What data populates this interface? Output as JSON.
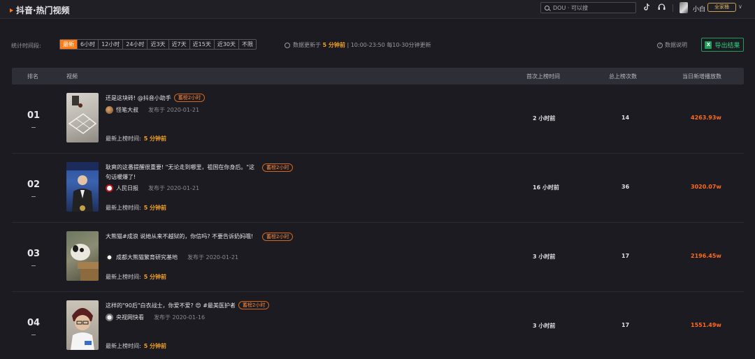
{
  "header": {
    "title": "抖音·热门视频",
    "search_placeholder": "DOU · 可以搜",
    "user_name": "小白",
    "user_badge": "全家桶"
  },
  "filters": {
    "label": "统计时间段:",
    "tabs": [
      "最新",
      "6小时",
      "12小时",
      "24小时",
      "近3天",
      "近7天",
      "近15天",
      "近30天",
      "不限"
    ],
    "active_index": 0,
    "update_prefix": "数据更新于",
    "update_value": "5 分钟前",
    "update_suffix": "| 10:00-23:50 每10-30分钟更新",
    "data_note": "数据说明",
    "export_label": "导出结果",
    "export_icon_letter": "X"
  },
  "table": {
    "columns": {
      "rank": "排名",
      "video": "视频",
      "first_time": "首次上榜时间",
      "total_count": "总上榜次数",
      "daily_plays": "当日新增播放数"
    },
    "latest_label": "最新上榜时间:",
    "rows": [
      {
        "rank": "01",
        "title": "还是这块砖! @抖音小助手",
        "tag": "蓄榜2小时",
        "author": "怪笔大叔",
        "published": "发布于 2020-01-21",
        "latest": "5 分钟前",
        "first_time": "2 小时前",
        "total_count": "14",
        "daily_plays": "4263.93w"
      },
      {
        "rank": "02",
        "title": "耿爽的这番提醒很重要! \"无论走到哪里，祖国在你身后。\"这句话暖爆了!",
        "tag": "蓄榜2小时",
        "author": "人民日报",
        "published": "发布于 2020-01-21",
        "latest": "5 分钟前",
        "first_time": "16 小时前",
        "total_count": "36",
        "daily_plays": "3020.07w"
      },
      {
        "rank": "03",
        "title": "大熊猫#成浪 说她从来不越狱的，你信吗? 不要告诉奶妈哦!",
        "tag": "蓄榜2小时",
        "author": "成都大熊猫繁育研究基地",
        "published": "发布于 2020-01-21",
        "latest": "5 分钟前",
        "first_time": "3 小时前",
        "total_count": "17",
        "daily_plays": "2196.45w"
      },
      {
        "rank": "04",
        "title": "这样的\"90后\"白衣战士，你爱不爱? 😍 #最美医护者",
        "tag": "蓄榜2小时",
        "author": "央视网快看",
        "published": "发布于 2020-01-16",
        "latest": "5 分钟前",
        "first_time": "3 小时前",
        "total_count": "17",
        "daily_plays": "1551.49w"
      }
    ]
  },
  "colors": {
    "accent": "#ff7b16",
    "highlight": "#f4a223",
    "plays": "#ff6a1f",
    "export_green": "#1e9e5a"
  }
}
